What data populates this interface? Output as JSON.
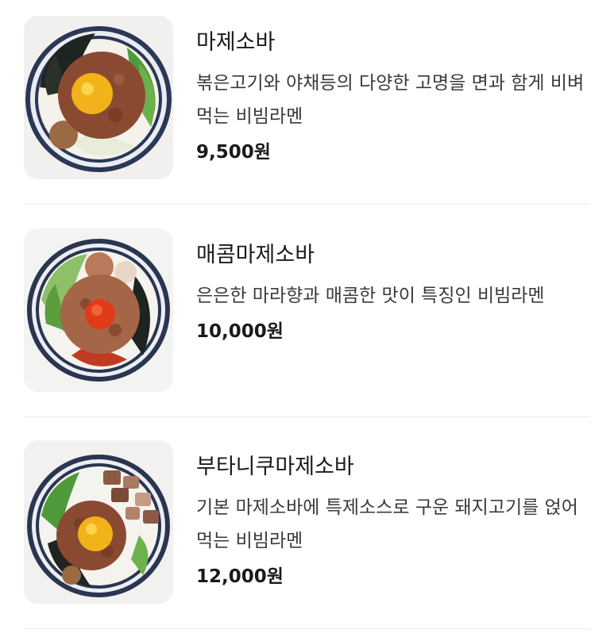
{
  "menu": {
    "items": [
      {
        "name": "마제소바",
        "description": "볶은고기와 야채등의 다양한 고명을 면과 함게 비벼먹는 비빔라멘",
        "price": "9,500원",
        "image": "mazesoba-bowl-egg-yolk"
      },
      {
        "name": "매콤마제소바",
        "description": "은은한 마라향과 매콤한 맛이 특징인 비빔라멘",
        "price": "10,000원",
        "image": "spicy-mazesoba-bowl-chili"
      },
      {
        "name": "부타니쿠마제소바",
        "description": "기본 마제소바에 특제소스로 구운 돼지고기를 얹어먹는 비빔라멘",
        "price": "12,000원",
        "image": "butaniku-mazesoba-bowl-pork"
      }
    ]
  },
  "colors": {
    "meat": "#8a4a32",
    "egg_yolk": "#f2b21a",
    "chili": "#e23a1a",
    "scallion": "#4e9a3a",
    "seaweed": "#1e2420",
    "bowl_stripe": "#2a3550"
  }
}
